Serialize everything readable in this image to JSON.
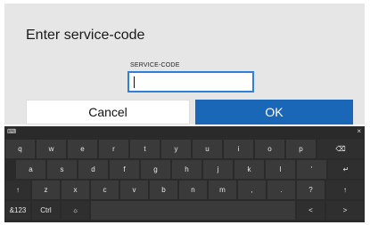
{
  "dialog": {
    "title": "Enter service-code",
    "field_label": "SERVICE-CODE",
    "field_value": "",
    "cancel_label": "Cancel",
    "ok_label": "OK"
  },
  "keyboard": {
    "close_glyph": "×",
    "row1": [
      "q",
      "w",
      "e",
      "r",
      "t",
      "y",
      "u",
      "i",
      "o",
      "p",
      "⌫"
    ],
    "row2": [
      "a",
      "s",
      "d",
      "f",
      "g",
      "h",
      "j",
      "k",
      "l",
      "'",
      "↵"
    ],
    "row3": [
      "↑",
      "z",
      "x",
      "c",
      "v",
      "b",
      "n",
      "m",
      ",",
      ".",
      "?",
      "↑"
    ],
    "row4": [
      "&123",
      "Ctrl",
      "☼",
      "",
      "<",
      ">"
    ]
  },
  "colors": {
    "dialog_bg": "#e6e6e6",
    "accent": "#1a67b8",
    "keyboard_bg": "#2a2a2a",
    "key_bg": "#3a3a3a"
  }
}
